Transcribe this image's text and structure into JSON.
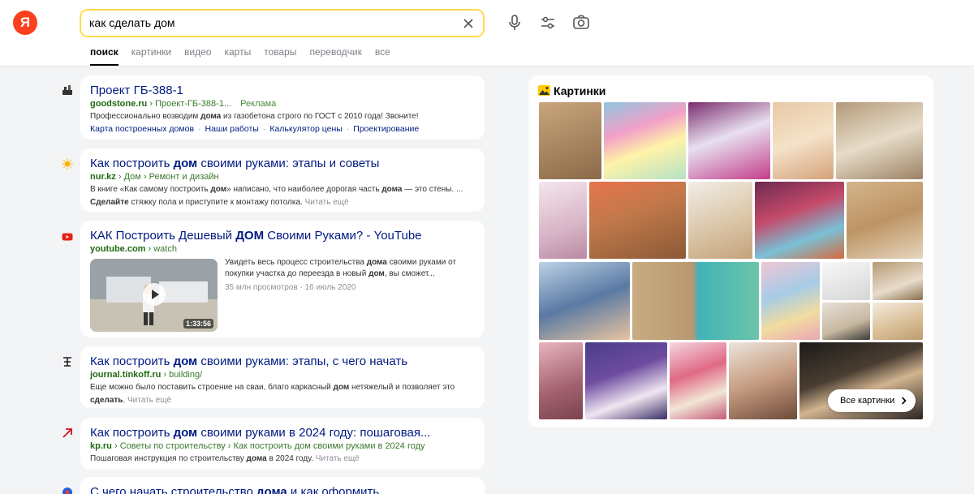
{
  "header": {
    "logo_text": "Я",
    "search_value": "как сделать дом",
    "tabs": [
      "поиск",
      "картинки",
      "видео",
      "карты",
      "товары",
      "переводчик",
      "все"
    ]
  },
  "results": [
    {
      "title": "Проект ГБ-388-1",
      "domain": "goodstone.ru",
      "path": "› Проект-ГБ-388-1...",
      "ad": "Реклама",
      "snippet_before": "Профессионально возводим ",
      "snippet_bold": "дома",
      "snippet_after": " из газобетона строго по ГОСТ с 2010 года! Звоните!",
      "sitelinks": [
        "Карта построенных домов",
        "Наши работы",
        "Калькулятор цены",
        "Проектирование"
      ]
    },
    {
      "title_before": "Как построить ",
      "title_bold": "дом",
      "title_after": " своими руками: этапы и советы",
      "domain": "nur.kz",
      "path": "› Дом › Ремонт и дизайн",
      "snippet_line1_before": "В книге «Как самому построить ",
      "snippet_line1_bold1": "дом",
      "snippet_line1_mid": "» написано, что наиболее дорогая часть ",
      "snippet_line1_bold2": "дома",
      "snippet_line1_after": " — это стены. ...",
      "snippet_line2_bold": "Сделайте",
      "snippet_line2_after": " стяжку пола и приступите к монтажу потолка.",
      "more": "Читать ещё"
    },
    {
      "title_before": "КАК Построить Дешевый ",
      "title_bold": "ДОМ",
      "title_after": " Своими Руками? - YouTube",
      "domain": "youtube.com",
      "path": "› watch",
      "desc_before": "Увидеть весь процесс строительства ",
      "desc_bold1": "дома",
      "desc_mid": " своими руками от покупки участка до переезда в новый ",
      "desc_bold2": "дом",
      "desc_after": ", вы сможет...",
      "meta": "35 млн просмотров · 16 июль 2020",
      "duration": "1:33:56"
    },
    {
      "title_before": "Как построить ",
      "title_bold": "дом",
      "title_after": " своими руками: этапы, с чего начать",
      "domain": "journal.tinkoff.ru",
      "path": "› building/",
      "snippet_line1_before": "Еще можно было поставить строение на сваи, благо каркасный ",
      "snippet_line1_bold": "дом",
      "snippet_line1_after": " нетяжелый и позволяет это",
      "snippet_line2_bold": "сделать",
      "snippet_line2_after": ".",
      "more": "Читать ещё"
    },
    {
      "title_before": "Как построить ",
      "title_bold": "дом",
      "title_after": " своими руками в 2024 году: пошаговая...",
      "domain": "kp.ru",
      "path": "› Советы по строительству › Как построить дом своими руками в 2024 году",
      "snippet_before": "Пошаговая инструкция по строительству ",
      "snippet_bold": "дома",
      "snippet_after": " в 2024 году.",
      "more": "Читать ещё"
    },
    {
      "title_before": "С чего начать строительство ",
      "title_bold": "дома",
      "title_after": " и как оформить..."
    }
  ],
  "images": {
    "title": "Картинки",
    "all_button": "Все картинки"
  },
  "colors": {
    "brand": "#fc3f1d",
    "search_border": "#ffdb4d",
    "link": "#001a80",
    "url": "#1e6b0f"
  }
}
